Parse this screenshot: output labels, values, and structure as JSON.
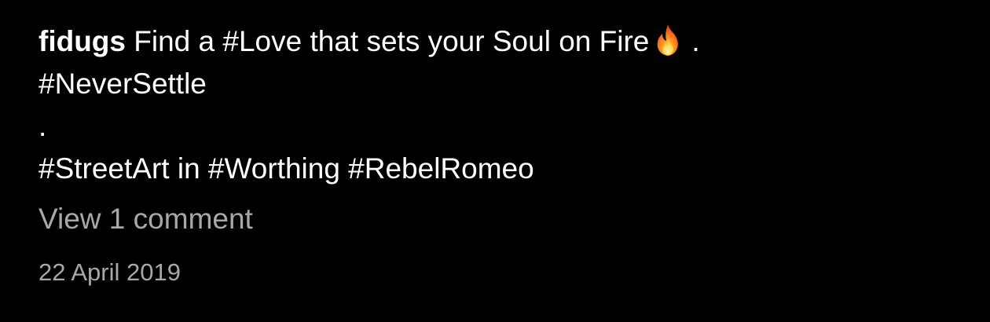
{
  "caption": {
    "username": "fidugs",
    "line1_text": "Find a #Love that sets your Soul on Fire",
    "line1_icon": "fire-icon",
    "line1_end": ".",
    "line2": "#NeverSettle",
    "line3": ".",
    "line4": "#StreetArt in #Worthing #RebelRomeo"
  },
  "comments": {
    "view_label": "View 1 comment"
  },
  "timestamp": "22 April 2019",
  "colors": {
    "background": "#000000",
    "text": "#ffffff",
    "muted": "#a8a8a8"
  }
}
